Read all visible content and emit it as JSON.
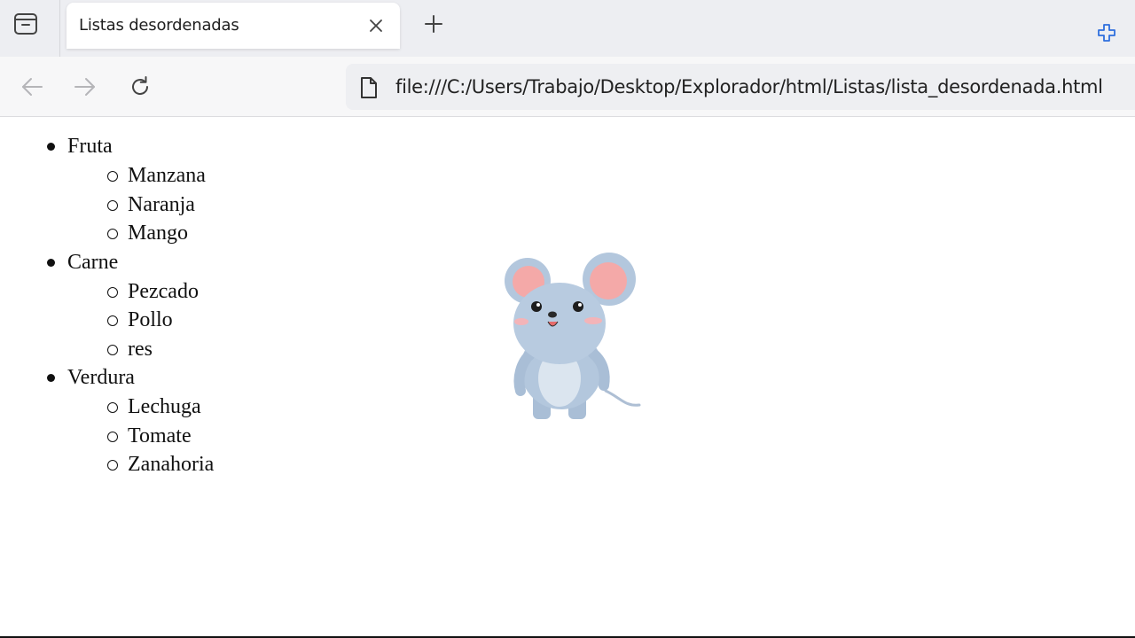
{
  "browser": {
    "tab": {
      "title": "Listas desordenadas"
    },
    "url": "file:///C:/Users/Trabajo/Desktop/Explorador/html/Listas/lista_desordenada.html"
  },
  "page": {
    "categories": [
      {
        "label": "Fruta",
        "items": [
          "Manzana",
          "Naranja",
          "Mango"
        ]
      },
      {
        "label": "Carne",
        "items": [
          "Pezcado",
          "Pollo",
          "res"
        ]
      },
      {
        "label": "Verdura",
        "items": [
          "Lechuga",
          "Tomate",
          "Zanahoria"
        ]
      }
    ]
  },
  "colors": {
    "tab_strip": "#edeef2",
    "toolbar": "#f7f7f8",
    "address_bar": "#eeeff2",
    "extension_icon": "#2f6fde",
    "mouse_body": "#b3c7dd",
    "mouse_ear_inner": "#f4a9a8"
  },
  "icons": [
    "workspaces-icon",
    "close-icon",
    "plus-icon",
    "extension-icon",
    "back-arrow-icon",
    "forward-arrow-icon",
    "reload-icon",
    "file-icon"
  ]
}
